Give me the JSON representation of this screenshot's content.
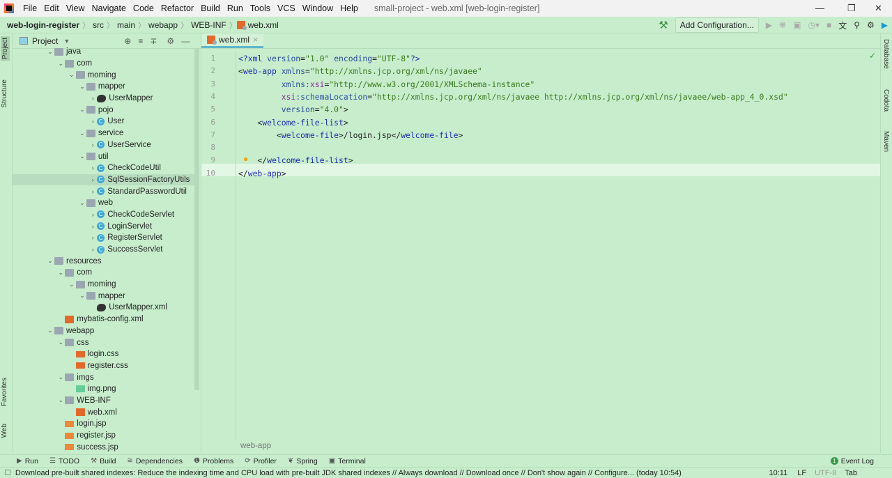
{
  "menubar": {
    "items": [
      "File",
      "Edit",
      "View",
      "Navigate",
      "Code",
      "Refactor",
      "Build",
      "Run",
      "Tools",
      "VCS",
      "Window",
      "Help"
    ],
    "title": "small-project - web.xml [web-login-register]"
  },
  "breadcrumb": [
    "web-login-register",
    "src",
    "main",
    "webapp",
    "WEB-INF",
    "web.xml"
  ],
  "toolbar": {
    "add_configuration": "Add Configuration..."
  },
  "left_tabs": {
    "project": "Project",
    "structure": "Structure",
    "favorites": "Favorites",
    "web": "Web"
  },
  "project_panel": {
    "title": "Project"
  },
  "tree": [
    {
      "label": "java",
      "depth": 0,
      "type": "folder",
      "open": true
    },
    {
      "label": "com",
      "depth": 1,
      "type": "folder",
      "open": true
    },
    {
      "label": "moming",
      "depth": 2,
      "type": "folder",
      "open": true
    },
    {
      "label": "mapper",
      "depth": 3,
      "type": "folder",
      "open": true
    },
    {
      "label": "UserMapper",
      "depth": 4,
      "type": "bird",
      "open": false
    },
    {
      "label": "pojo",
      "depth": 3,
      "type": "folder",
      "open": true
    },
    {
      "label": "User",
      "depth": 4,
      "type": "cls",
      "open": false
    },
    {
      "label": "service",
      "depth": 3,
      "type": "folder",
      "open": true
    },
    {
      "label": "UserService",
      "depth": 4,
      "type": "cls",
      "open": false
    },
    {
      "label": "util",
      "depth": 3,
      "type": "folder",
      "open": true
    },
    {
      "label": "CheckCodeUtil",
      "depth": 4,
      "type": "cls",
      "open": false
    },
    {
      "label": "SqlSessionFactoryUtils",
      "depth": 4,
      "type": "cls",
      "open": false,
      "selected": true
    },
    {
      "label": "StandardPasswordUtil",
      "depth": 4,
      "type": "cls",
      "open": false
    },
    {
      "label": "web",
      "depth": 3,
      "type": "folder",
      "open": true
    },
    {
      "label": "CheckCodeServlet",
      "depth": 4,
      "type": "cls",
      "open": false
    },
    {
      "label": "LoginServlet",
      "depth": 4,
      "type": "cls",
      "open": false
    },
    {
      "label": "RegisterServlet",
      "depth": 4,
      "type": "cls",
      "open": false
    },
    {
      "label": "SuccessServlet",
      "depth": 4,
      "type": "cls",
      "open": false
    },
    {
      "label": "resources",
      "depth": 0,
      "type": "folder",
      "open": true
    },
    {
      "label": "com",
      "depth": 1,
      "type": "folder",
      "open": true
    },
    {
      "label": "moming",
      "depth": 2,
      "type": "folder",
      "open": true
    },
    {
      "label": "mapper",
      "depth": 3,
      "type": "folder",
      "open": true
    },
    {
      "label": "UserMapper.xml",
      "depth": 4,
      "type": "bird",
      "leaf": true
    },
    {
      "label": "mybatis-config.xml",
      "depth": 1,
      "type": "xml",
      "leaf": true
    },
    {
      "label": "webapp",
      "depth": 0,
      "type": "folder",
      "open": true
    },
    {
      "label": "css",
      "depth": 1,
      "type": "folder",
      "open": true
    },
    {
      "label": "login.css",
      "depth": 2,
      "type": "css",
      "leaf": true
    },
    {
      "label": "register.css",
      "depth": 2,
      "type": "css",
      "leaf": true
    },
    {
      "label": "imgs",
      "depth": 1,
      "type": "folder",
      "open": true
    },
    {
      "label": "img.png",
      "depth": 2,
      "type": "png",
      "leaf": true
    },
    {
      "label": "WEB-INF",
      "depth": 1,
      "type": "folder",
      "open": true
    },
    {
      "label": "web.xml",
      "depth": 2,
      "type": "xml",
      "leaf": true
    },
    {
      "label": "login.jsp",
      "depth": 1,
      "type": "jsp",
      "leaf": true
    },
    {
      "label": "register.jsp",
      "depth": 1,
      "type": "jsp",
      "leaf": true
    },
    {
      "label": "success.jsp",
      "depth": 1,
      "type": "jsp",
      "leaf": true
    }
  ],
  "editor": {
    "tab": "web.xml",
    "footer_breadcrumb": "web-app",
    "lines": [
      "<span class=\"t\">&lt;?xml </span><span class=\"a\">version</span>=<span class=\"v\">\"1.0\"</span> <span class=\"a\">encoding</span>=<span class=\"v\">\"UTF-8\"</span><span class=\"t\">?&gt;</span>",
      "&lt;<span class=\"t\">web-app</span> <span class=\"a\">xmlns</span>=<span class=\"v\">\"http://xmlns.jcp.org/xml/ns/javaee\"</span>",
      "         <span class=\"a\">xmlns:</span><span class=\"n\">xsi</span>=<span class=\"v\">\"http://www.w3.org/2001/XMLSchema-instance\"</span>",
      "         <span class=\"n\">xsi</span><span class=\"a\">:schemaLocation</span>=<span class=\"v\">\"http://xmlns.jcp.org/xml/ns/javaee http://xmlns.jcp.org/xml/ns/javaee/web-app_4_0.xsd\"</span>",
      "         <span class=\"a\">version</span>=<span class=\"v\">\"4.0\"</span>&gt;",
      "    &lt;<span class=\"t\">welcome-file-list</span>&gt;",
      "        &lt;<span class=\"t\">welcome-file</span>&gt;/login.jsp&lt;/<span class=\"t\">welcome-file</span>&gt;",
      "",
      "    &lt;/<span class=\"t\">welcome-file-list</span>&gt;",
      "&lt;/<span class=\"t\">web-app</span>&gt;"
    ]
  },
  "right_tabs": {
    "database": "Database",
    "codota": "Codota",
    "maven": "Maven"
  },
  "bottom_tools": [
    "Run",
    "TODO",
    "Build",
    "Dependencies",
    "Problems",
    "Profiler",
    "Spring",
    "Terminal"
  ],
  "event_log": {
    "label": "Event Log",
    "count": "1"
  },
  "status": {
    "message": "Download pre-built shared indexes: Reduce the indexing time and CPU load with pre-built JDK shared indexes // Always download // Download once // Don't show again // Configure... (today 10:54)",
    "position": "10:11",
    "line_sep": "LF",
    "encoding": "UTF-8",
    "indent": "Tab"
  }
}
